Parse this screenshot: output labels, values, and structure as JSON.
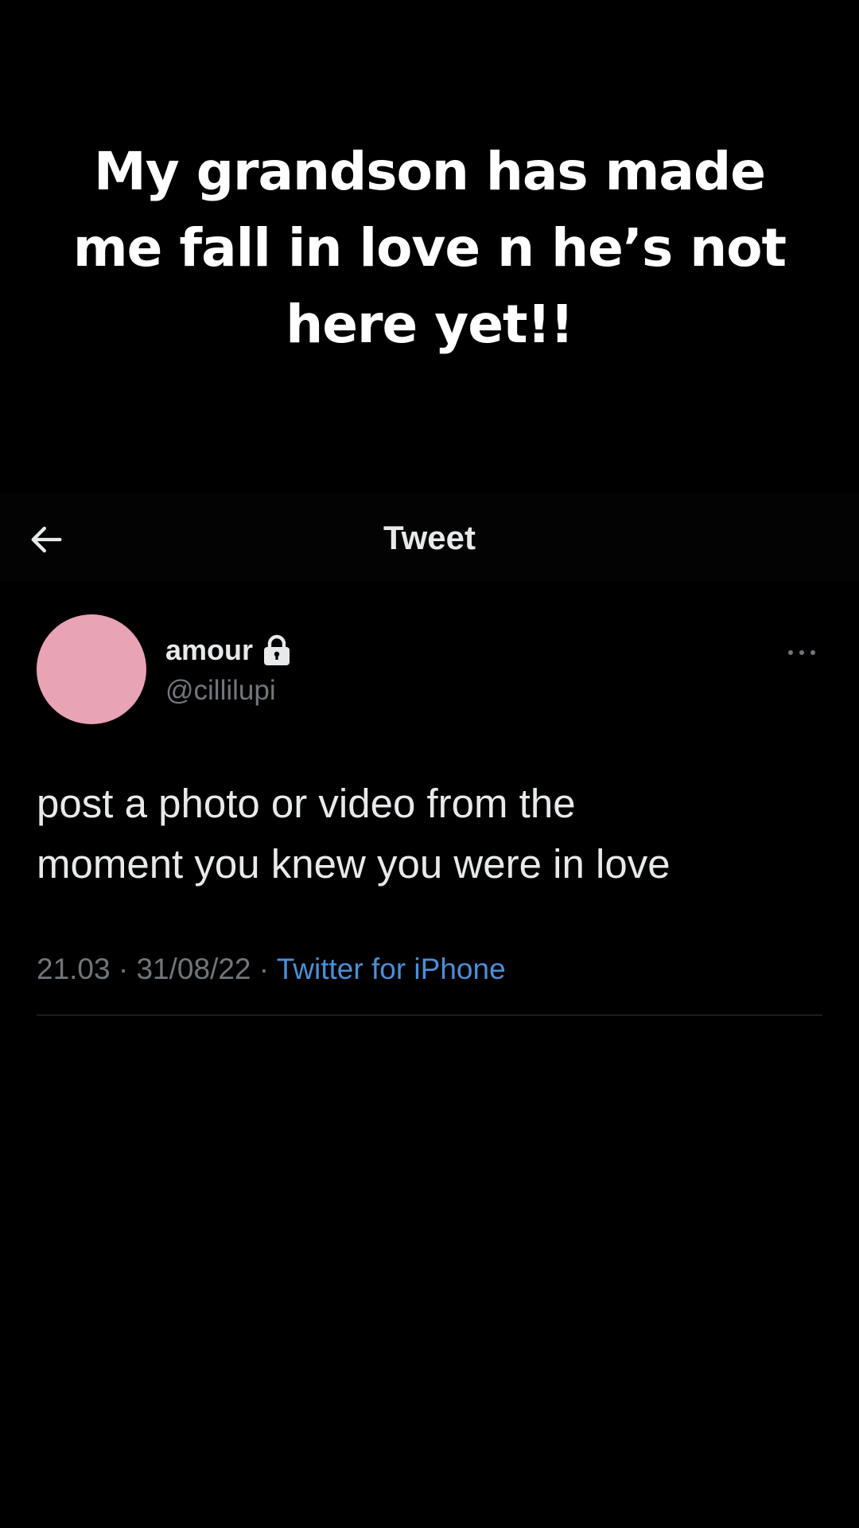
{
  "caption": {
    "line1": "My grandson has made",
    "line2": "me fall in love n he’s not",
    "line3": "here yet!!"
  },
  "nav": {
    "back_icon": "arrow-left-icon",
    "title": "Tweet"
  },
  "tweet": {
    "author": {
      "display_name": "amour",
      "handle": "@cillilupi",
      "avatar_color": "#e8a3b4",
      "protected_icon": "lock-icon"
    },
    "more_icon": "more-horizontal-icon",
    "text": {
      "line1": "post a photo or video from the",
      "line2": "moment you knew you were in love"
    },
    "meta": {
      "time": "21.03",
      "separator": " · ",
      "date": "31/08/22",
      "source": "Twitter for iPhone"
    }
  },
  "colors": {
    "background": "#000000",
    "primary_text": "#e7e9ea",
    "secondary_text": "#71767b",
    "link": "#4a8fd8"
  }
}
